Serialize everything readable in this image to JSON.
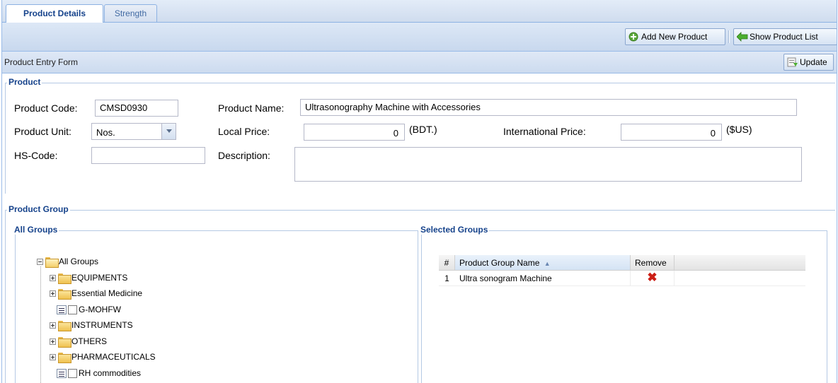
{
  "tabs": [
    {
      "label": "Product Details",
      "active": true
    },
    {
      "label": "Strength",
      "active": false
    }
  ],
  "toolbar": {
    "add_label": "Add New Product",
    "list_label": "Show Product List"
  },
  "form": {
    "title": "Product Entry Form",
    "update_label": "Update"
  },
  "product": {
    "legend": "Product",
    "code_label": "Product Code:",
    "code_value": "CMSD0930",
    "name_label": "Product Name:",
    "name_value": "Ultrasonography Machine with Accessories",
    "unit_label": "Product Unit:",
    "unit_value": "Nos.",
    "local_price_label": "Local Price:",
    "local_price_value": "0",
    "local_unit": "(BDT.)",
    "intl_price_label": "International Price:",
    "intl_price_value": "0",
    "intl_unit": "($US)",
    "hs_label": "HS-Code:",
    "hs_value": "",
    "desc_label": "Description:",
    "desc_value": ""
  },
  "group": {
    "legend": "Product Group",
    "all_legend": "All Groups",
    "selected_legend": "Selected Groups",
    "tree": {
      "root": "All Groups",
      "children": [
        {
          "label": "EQUIPMENTS",
          "type": "folder"
        },
        {
          "label": "Essential Medicine",
          "type": "folder"
        },
        {
          "label": "G-MOHFW",
          "type": "leaf"
        },
        {
          "label": "INSTRUMENTS",
          "type": "folder"
        },
        {
          "label": "OTHERS",
          "type": "folder"
        },
        {
          "label": "PHARMACEUTICALS",
          "type": "folder"
        },
        {
          "label": "RH commodities",
          "type": "leaf"
        }
      ]
    },
    "grid": {
      "col_num": "#",
      "col_name": "Product Group Name",
      "col_remove": "Remove",
      "rows": [
        {
          "num": "1",
          "name": "Ultra sonogram Machine"
        }
      ]
    }
  },
  "colors": {
    "header_blue": "#15428b",
    "border_blue": "#99bbe8",
    "remove_red": "#cc1f16"
  }
}
